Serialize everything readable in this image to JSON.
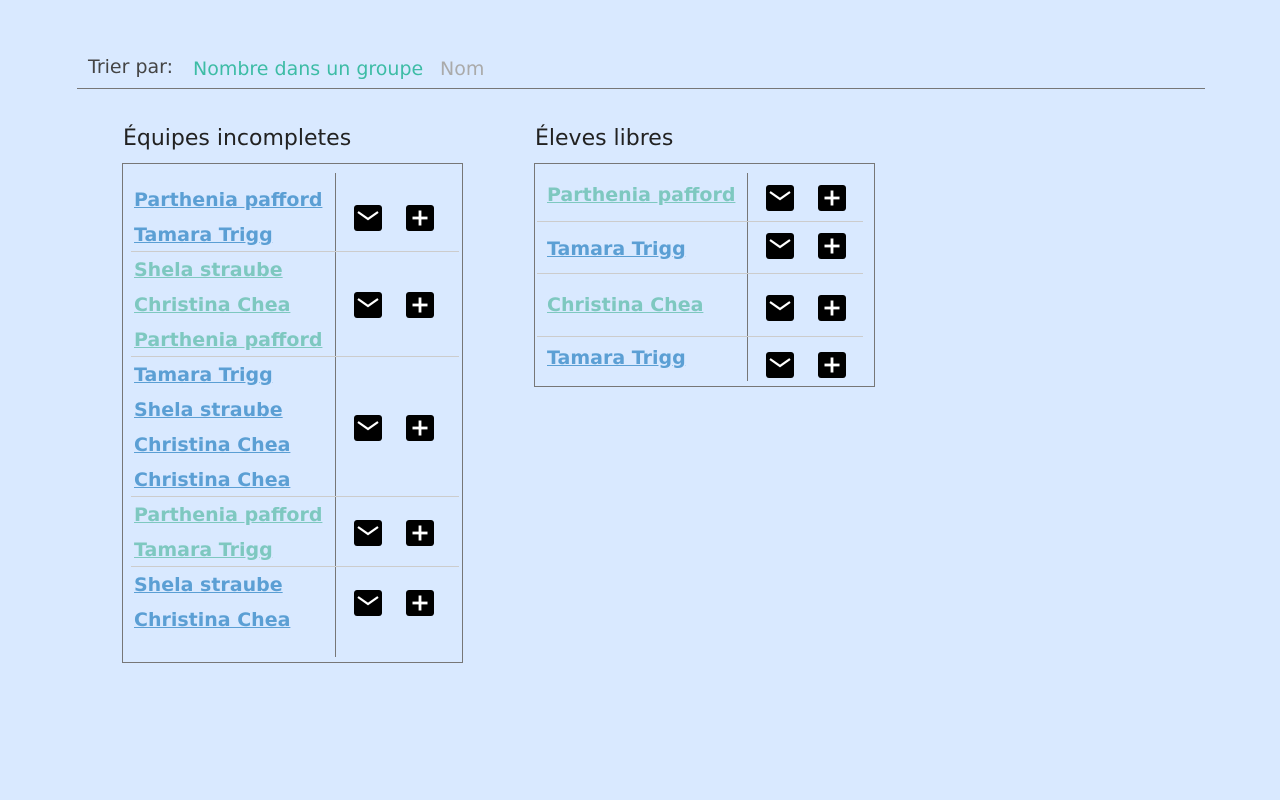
{
  "sort": {
    "label": "Trier par:",
    "active": "Nombre dans un groupe",
    "inactive": "Nom"
  },
  "incomplete": {
    "title": "Équipes incompletes",
    "teams": [
      {
        "members": [
          {
            "name": "Parthenia pafford",
            "tone": "blue"
          },
          {
            "name": "Tamara Trigg",
            "tone": "blue"
          }
        ]
      },
      {
        "members": [
          {
            "name": "Shela straube",
            "tone": "teal"
          },
          {
            "name": "Christina Chea",
            "tone": "teal"
          },
          {
            "name": "Parthenia pafford",
            "tone": "teal"
          }
        ]
      },
      {
        "members": [
          {
            "name": "Tamara Trigg",
            "tone": "blue"
          },
          {
            "name": "Shela straube",
            "tone": "blue"
          },
          {
            "name": "Christina Chea",
            "tone": "blue"
          },
          {
            "name": "Christina Chea",
            "tone": "blue"
          }
        ]
      },
      {
        "members": [
          {
            "name": "Parthenia pafford",
            "tone": "teal"
          },
          {
            "name": "Tamara Trigg",
            "tone": "teal"
          }
        ]
      },
      {
        "members": [
          {
            "name": "Shela straube",
            "tone": "blue"
          },
          {
            "name": "Christina Chea",
            "tone": "blue"
          }
        ]
      }
    ]
  },
  "free": {
    "title": "Éleves libres",
    "students": [
      {
        "name": "Parthenia pafford",
        "tone": "teal"
      },
      {
        "name": "Tamara Trigg",
        "tone": "blue"
      },
      {
        "name": "Christina Chea",
        "tone": "teal"
      },
      {
        "name": "Tamara Trigg",
        "tone": "blue"
      }
    ]
  },
  "icons": {
    "mail": "mail-icon",
    "add": "add-icon"
  },
  "colors": {
    "background": "#d9e9ff",
    "accent": "#3dbca5",
    "name_blue": "#5b9fd4",
    "name_teal": "#7ec8c0",
    "inactive": "#aaaaaa"
  }
}
